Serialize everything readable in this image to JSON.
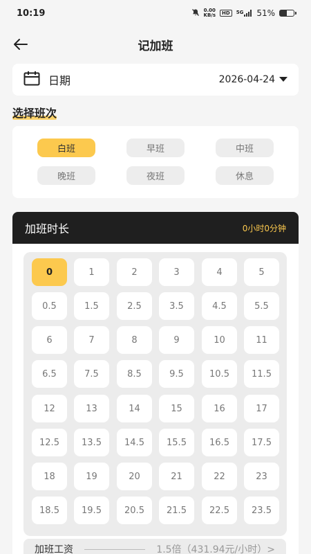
{
  "status_bar": {
    "time": "10:19",
    "net_speed_top": "0.00",
    "net_speed_unit": "KB/s",
    "hd": "HD",
    "network": "5G",
    "battery": "51%",
    "battery_level": 0.51
  },
  "header": {
    "title": "记加班"
  },
  "date": {
    "label": "日期",
    "value": "2026-04-24"
  },
  "shift": {
    "title": "选择班次",
    "options": [
      {
        "label": "白班",
        "active": true
      },
      {
        "label": "早班",
        "active": false
      },
      {
        "label": "中班",
        "active": false
      },
      {
        "label": "晚班",
        "active": false
      },
      {
        "label": "夜班",
        "active": false
      },
      {
        "label": "休息",
        "active": false
      }
    ]
  },
  "duration": {
    "title": "加班时长",
    "value": "0小时0分钟",
    "hours": [
      "0",
      "1",
      "2",
      "3",
      "4",
      "5",
      "0.5",
      "1.5",
      "2.5",
      "3.5",
      "4.5",
      "5.5",
      "6",
      "7",
      "8",
      "9",
      "10",
      "11",
      "6.5",
      "7.5",
      "8.5",
      "9.5",
      "10.5",
      "11.5",
      "12",
      "13",
      "14",
      "15",
      "16",
      "17",
      "12.5",
      "13.5",
      "14.5",
      "15.5",
      "16.5",
      "17.5",
      "18",
      "19",
      "20",
      "21",
      "22",
      "23",
      "18.5",
      "19.5",
      "20.5",
      "21.5",
      "22.5",
      "23.5"
    ],
    "selected": "0"
  },
  "wage": {
    "label": "加班工资",
    "value": "1.5倍（431.94元/小时）>"
  },
  "colors": {
    "accent": "#fcc94e",
    "dark_header": "#1f1f1f",
    "background": "#f5f5f5"
  }
}
